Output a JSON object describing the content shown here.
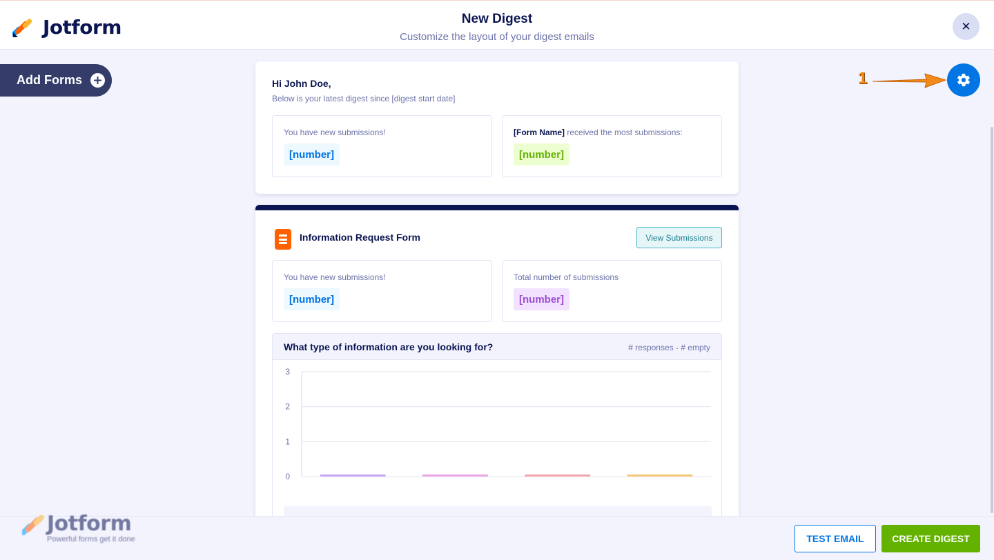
{
  "header": {
    "logo_text": "Jotform",
    "title": "New Digest",
    "subtitle": "Customize the layout of your digest emails",
    "close_glyph": "✕"
  },
  "sidebar": {
    "add_forms_label": "Add Forms",
    "add_icon": "plus-circle-icon"
  },
  "annotation": {
    "number": "1",
    "color": "#f28a1a"
  },
  "settings": {
    "icon": "gear-icon",
    "color": "#0075e3"
  },
  "summary_card": {
    "greeting": "Hi John Doe,",
    "intro": "Below is your latest digest since [digest start date]",
    "stats": [
      {
        "label_bold": "",
        "label": "You have new submissions!",
        "value": "[number]",
        "color": "#0075e3"
      },
      {
        "label_bold": "[Form Name]",
        "label": " received the most submissions:",
        "value": "[number]",
        "color": "#64b200"
      }
    ]
  },
  "form_card": {
    "accent_color": "#0a1551",
    "form_icon": "form-document-icon",
    "form_title": "Information Request Form",
    "view_button": "View Submissions",
    "stats": [
      {
        "label": "You have new submissions!",
        "value": "[number]",
        "color": "#0075e3"
      },
      {
        "label": "Total number of submissions",
        "value": "[number]",
        "color": "#9c4dd3"
      }
    ],
    "question": {
      "title": "What type of information are you looking for?",
      "meta": "# responses - # empty"
    }
  },
  "chart_data": {
    "type": "bar",
    "title": "",
    "xlabel": "",
    "ylabel": "",
    "ylim": [
      0,
      3
    ],
    "y_ticks": [
      "3",
      "2",
      "1",
      "0"
    ],
    "grid": true,
    "categories": [
      "",
      "",
      "",
      ""
    ],
    "values": [
      0,
      0,
      0,
      0
    ],
    "bar_colors": [
      "#c9a6f2",
      "#e9a6e6",
      "#f3a6ad",
      "#f6c97a"
    ]
  },
  "footer": {
    "watermark_logo": "Jotform",
    "watermark_tagline": "Powerful forms get it done",
    "test_email": "TEST EMAIL",
    "create_digest": "CREATE DIGEST"
  }
}
